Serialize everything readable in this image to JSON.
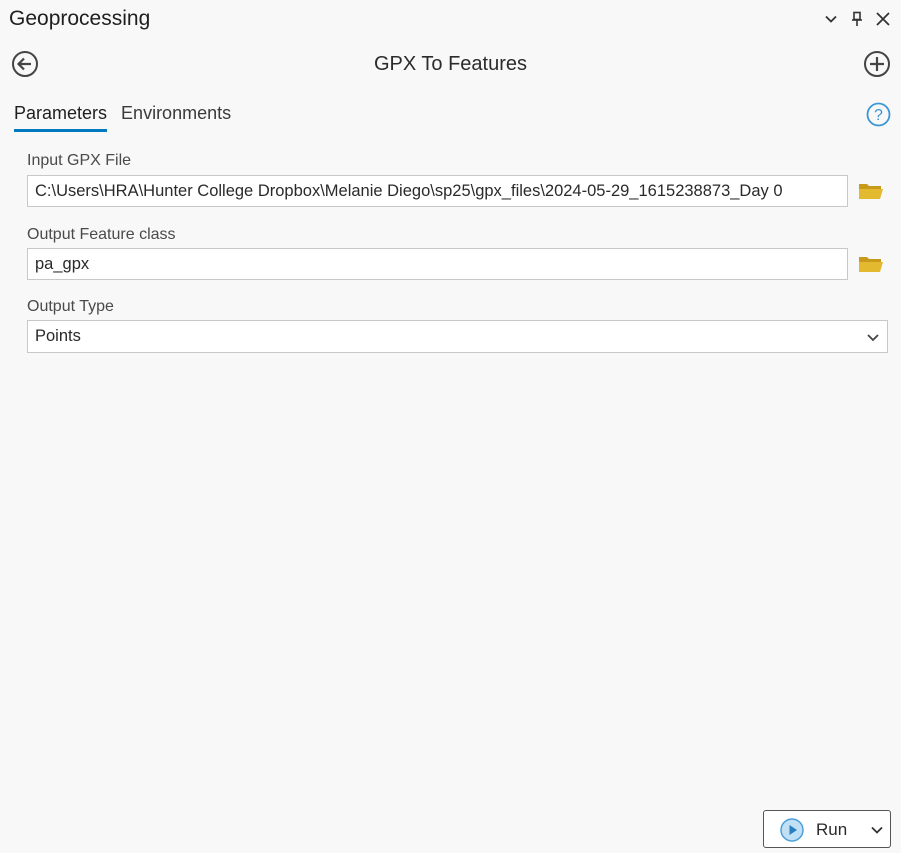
{
  "pane": {
    "title": "Geoprocessing",
    "icons": [
      "chevron-down-icon",
      "pin-icon",
      "close-icon"
    ]
  },
  "tool": {
    "name": "GPX To Features",
    "back_icon": "back-arrow-icon",
    "add_icon": "add-icon"
  },
  "tabs": [
    {
      "label": "Parameters",
      "active": true
    },
    {
      "label": "Environments",
      "active": false
    }
  ],
  "help_icon": "help-icon",
  "params": {
    "input_gpx": {
      "label": "Input GPX File",
      "value": "C:\\Users\\HRA\\Hunter College Dropbox\\Melanie Diego\\sp25\\gpx_files\\2024-05-29_1615238873_Day 0"
    },
    "output_fc": {
      "label": "Output Feature class",
      "value": "pa_gpx"
    },
    "output_type": {
      "label": "Output Type",
      "value": "Points"
    }
  },
  "run_button": {
    "label": "Run"
  },
  "colors": {
    "accent": "#0079c1",
    "folder": "#e3b930",
    "background": "#f8f8f8"
  }
}
